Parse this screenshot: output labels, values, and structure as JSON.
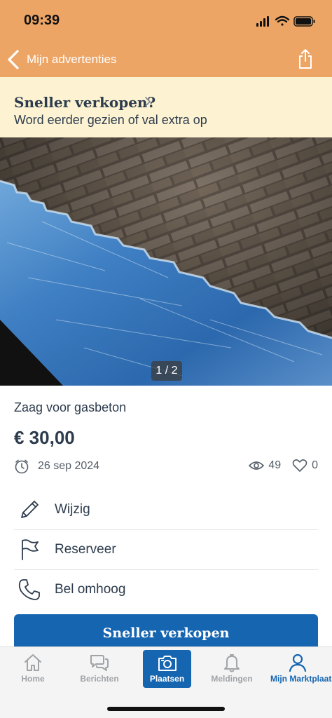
{
  "status_bar": {
    "time": "09:39"
  },
  "nav": {
    "back_label": "Mijn advertenties"
  },
  "promo": {
    "title": "Sneller verkopen?",
    "subtitle": "Word eerder gezien of val extra op"
  },
  "photo": {
    "counter": "1 / 2"
  },
  "listing": {
    "title": "Zaag voor gasbeton",
    "price": "€ 30,00",
    "date": "26 sep 2024",
    "views": "49",
    "favorites": "0"
  },
  "actions": [
    {
      "label": "Wijzig",
      "icon": "pencil-icon"
    },
    {
      "label": "Reserveer",
      "icon": "flag-icon"
    },
    {
      "label": "Bel omhoog",
      "icon": "phone-icon"
    }
  ],
  "cta": {
    "label": "Sneller verkopen"
  },
  "tabbar": {
    "tabs": [
      {
        "label": "Home",
        "icon": "home-icon"
      },
      {
        "label": "Berichten",
        "icon": "chat-icon"
      },
      {
        "label": "Plaatsen",
        "icon": "camera-icon"
      },
      {
        "label": "Meldingen",
        "icon": "bell-icon"
      },
      {
        "label": "Mijn Marktplaats",
        "icon": "user-icon"
      }
    ]
  },
  "colors": {
    "header": "#eda566",
    "promo_bg": "#fdf3d3",
    "primary": "#1665b1",
    "text": "#2d3c4d"
  }
}
